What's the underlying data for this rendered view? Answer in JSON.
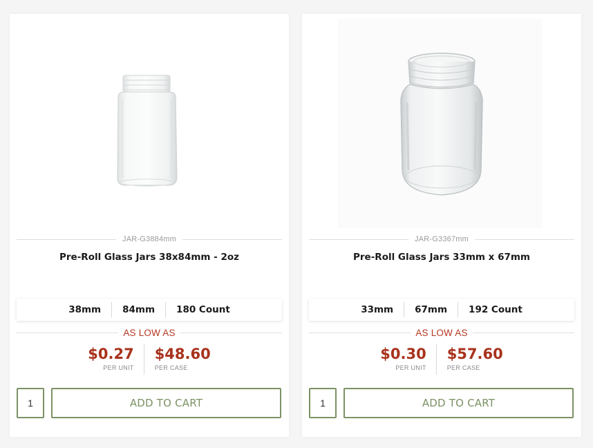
{
  "products": [
    {
      "sku": "JAR-G3884mm",
      "title": "Pre-Roll Glass Jars 38x84mm - 2oz",
      "specs": [
        "38mm",
        "84mm",
        "180 Count"
      ],
      "low_label": "AS LOW AS",
      "unit_price": "$0.27",
      "unit_label": "PER UNIT",
      "case_price": "$48.60",
      "case_label": "PER CASE",
      "qty": "1",
      "cart_label": "ADD TO CART"
    },
    {
      "sku": "JAR-G3367mm",
      "title": "Pre-Roll Glass Jars 33mm x 67mm",
      "specs": [
        "33mm",
        "67mm",
        "192 Count"
      ],
      "low_label": "AS LOW AS",
      "unit_price": "$0.30",
      "unit_label": "PER UNIT",
      "case_price": "$57.60",
      "case_label": "PER CASE",
      "qty": "1",
      "cart_label": "ADD TO CART"
    }
  ],
  "colors": {
    "price_red": "#a8321c",
    "accent_green": "#7b9163"
  }
}
